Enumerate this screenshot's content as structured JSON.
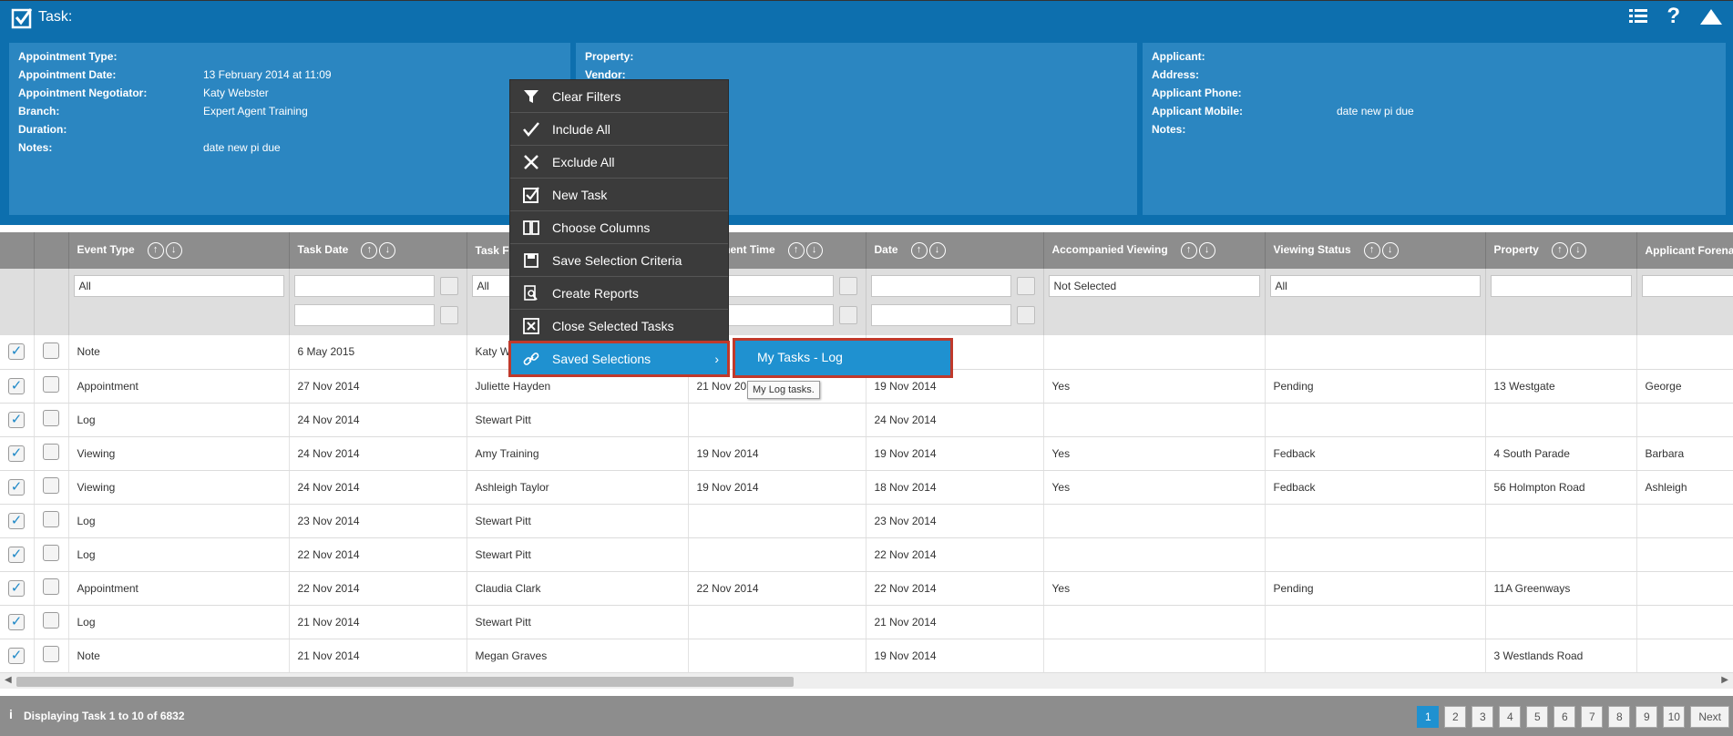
{
  "header": {
    "title": "Task:"
  },
  "info_left": [
    {
      "label": "Appointment Type:",
      "value": ""
    },
    {
      "label": "Appointment Date:",
      "value": "13 February 2014 at 11:09"
    },
    {
      "label": "Appointment Negotiator:",
      "value": "Katy Webster"
    },
    {
      "label": "Branch:",
      "value": "Expert Agent Training"
    },
    {
      "label": "Duration:",
      "value": ""
    },
    {
      "label": "Notes:",
      "value": "date new pi due"
    }
  ],
  "info_mid": [
    {
      "label": "Property:",
      "value": ""
    },
    {
      "label": "Vendor:",
      "value": ""
    }
  ],
  "info_right": [
    {
      "label": "Applicant:",
      "value": ""
    },
    {
      "label": "Address:",
      "value": ""
    },
    {
      "label": "Applicant Phone:",
      "value": ""
    },
    {
      "label": "Applicant Mobile:",
      "value": "date new pi due"
    },
    {
      "label": "Notes:",
      "value": ""
    }
  ],
  "columns": {
    "event_type": "Event Type",
    "task_date": "Task Date",
    "task_for": "Task Fo",
    "appointment_time": "ntment Time",
    "date": "Date",
    "accompanied": "Accompanied Viewing",
    "viewing_status": "Viewing Status",
    "property": "Property",
    "applicant_forename": "Applicant Forena"
  },
  "filters": {
    "event_type": "All",
    "task_for": "All",
    "accompanied": "Not Selected",
    "viewing_status": "All"
  },
  "rows": [
    {
      "event": "Note",
      "task_date": "6 May 2015",
      "task_for": "Katy W",
      "appt": "",
      "date": "",
      "accompanied": "",
      "status": "",
      "property": "",
      "forename": ""
    },
    {
      "event": "Appointment",
      "task_date": "27 Nov 2014",
      "task_for": "Juliette Hayden",
      "appt": "21 Nov 2014",
      "date": "19 Nov 2014",
      "accompanied": "Yes",
      "status": "Pending",
      "property": "13 Westgate",
      "forename": "George"
    },
    {
      "event": "Log",
      "task_date": "24 Nov 2014",
      "task_for": "Stewart Pitt",
      "appt": "",
      "date": "24 Nov 2014",
      "accompanied": "",
      "status": "",
      "property": "",
      "forename": ""
    },
    {
      "event": "Viewing",
      "task_date": "24 Nov 2014",
      "task_for": "Amy Training",
      "appt": "19 Nov 2014",
      "date": "19 Nov 2014",
      "accompanied": "Yes",
      "status": "Fedback",
      "property": "4 South Parade",
      "forename": "Barbara"
    },
    {
      "event": "Viewing",
      "task_date": "24 Nov 2014",
      "task_for": "Ashleigh Taylor",
      "appt": "19 Nov 2014",
      "date": "18 Nov 2014",
      "accompanied": "Yes",
      "status": "Fedback",
      "property": "56 Holmpton Road",
      "forename": "Ashleigh"
    },
    {
      "event": "Log",
      "task_date": "23 Nov 2014",
      "task_for": "Stewart Pitt",
      "appt": "",
      "date": "23 Nov 2014",
      "accompanied": "",
      "status": "",
      "property": "",
      "forename": ""
    },
    {
      "event": "Log",
      "task_date": "22 Nov 2014",
      "task_for": "Stewart Pitt",
      "appt": "",
      "date": "22 Nov 2014",
      "accompanied": "",
      "status": "",
      "property": "",
      "forename": ""
    },
    {
      "event": "Appointment",
      "task_date": "22 Nov 2014",
      "task_for": "Claudia Clark",
      "appt": "22 Nov 2014",
      "date": "22 Nov 2014",
      "accompanied": "Yes",
      "status": "Pending",
      "property": "11A Greenways",
      "forename": ""
    },
    {
      "event": "Log",
      "task_date": "21 Nov 2014",
      "task_for": "Stewart Pitt",
      "appt": "",
      "date": "21 Nov 2014",
      "accompanied": "",
      "status": "",
      "property": "",
      "forename": ""
    },
    {
      "event": "Note",
      "task_date": "21 Nov 2014",
      "task_for": "Megan Graves",
      "appt": "",
      "date": "19 Nov 2014",
      "accompanied": "",
      "status": "",
      "property": "3 Westlands Road",
      "forename": ""
    }
  ],
  "context_menu": [
    {
      "label": "Clear Filters",
      "icon": "filter-icon"
    },
    {
      "label": "Include All",
      "icon": "checkmark-icon"
    },
    {
      "label": "Exclude All",
      "icon": "x-icon"
    },
    {
      "label": "New Task",
      "icon": "checkbox-icon"
    },
    {
      "label": "Choose Columns",
      "icon": "columns-icon"
    },
    {
      "label": "Save Selection Criteria",
      "icon": "save-icon"
    },
    {
      "label": "Create Reports",
      "icon": "report-icon"
    },
    {
      "label": "Close Selected Tasks",
      "icon": "close-box-icon"
    },
    {
      "label": "Saved Selections",
      "icon": "link-icon"
    }
  ],
  "submenu": {
    "label": "My Tasks - Log"
  },
  "tooltip": "My Log tasks.",
  "footer": {
    "displaying": "Displaying Task 1 to 10 of 6832",
    "pages": [
      "1",
      "2",
      "3",
      "4",
      "5",
      "6",
      "7",
      "8",
      "9",
      "10"
    ],
    "next": "Next",
    "current_page": "1"
  },
  "colors": {
    "brand": "#0d6fae",
    "panel": "#2b86c1",
    "accent": "#1f91d0",
    "highlight_border": "#c0392b"
  }
}
